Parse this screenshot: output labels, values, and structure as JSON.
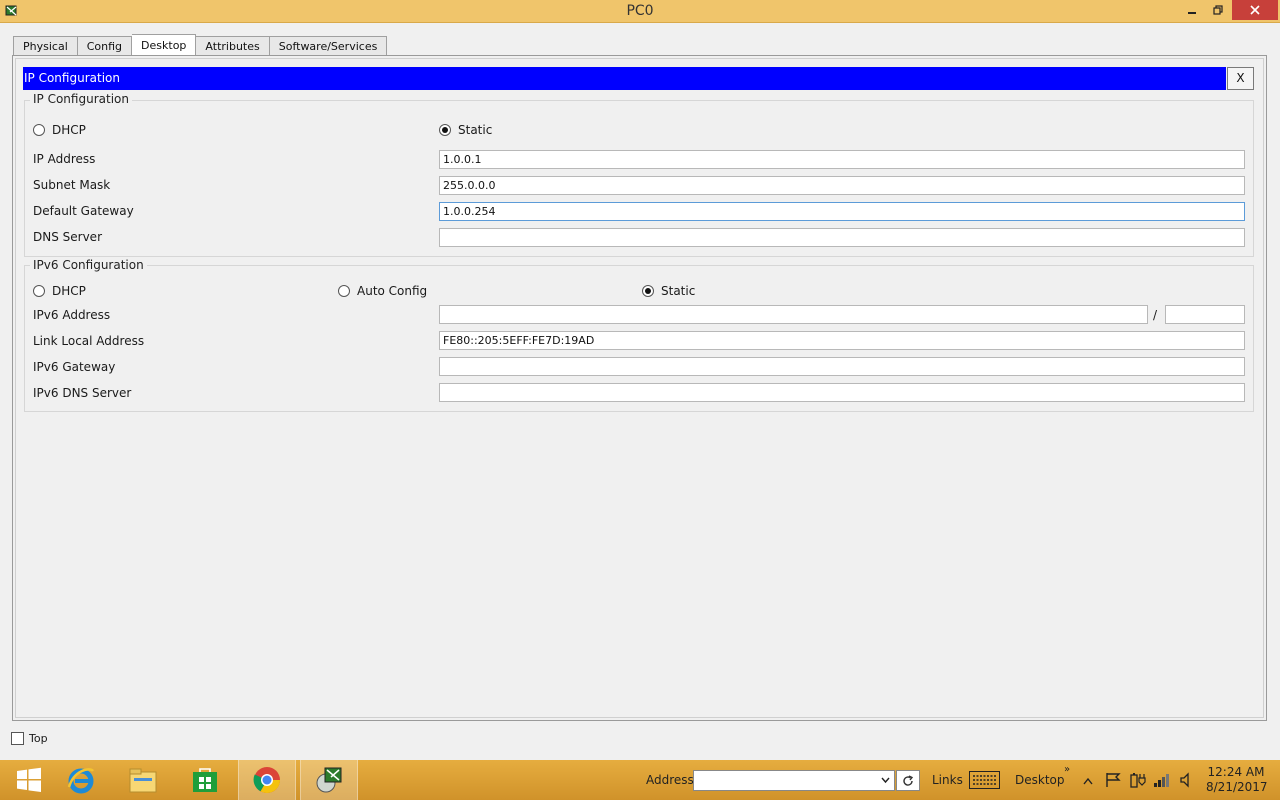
{
  "window": {
    "title": "PC0"
  },
  "tabs": [
    "Physical",
    "Config",
    "Desktop",
    "Attributes",
    "Software/Services"
  ],
  "ip_config": {
    "header": "IP Configuration",
    "close_label": "X",
    "ipv4": {
      "group_title": "IP Configuration",
      "dhcp_label": "DHCP",
      "static_label": "Static",
      "mode": "Static",
      "ip_address_label": "IP Address",
      "ip_address": "1.0.0.1",
      "subnet_mask_label": "Subnet Mask",
      "subnet_mask": "255.0.0.0",
      "default_gateway_label": "Default Gateway",
      "default_gateway": "1.0.0.254",
      "dns_server_label": "DNS Server",
      "dns_server": ""
    },
    "ipv6": {
      "group_title": "IPv6 Configuration",
      "dhcp_label": "DHCP",
      "auto_config_label": "Auto Config",
      "static_label": "Static",
      "mode": "Static",
      "ipv6_address_label": "IPv6 Address",
      "ipv6_address": "",
      "slash": "/",
      "prefix_length": "",
      "link_local_label": "Link Local Address",
      "link_local": "FE80::205:5EFF:FE7D:19AD",
      "ipv6_gateway_label": "IPv6 Gateway",
      "ipv6_gateway": "",
      "ipv6_dns_label": "IPv6 DNS Server",
      "ipv6_dns": ""
    }
  },
  "top_checkbox": {
    "label": "Top",
    "checked": false
  },
  "taskbar": {
    "address_label": "Address",
    "links_label": "Links",
    "desktop_label": "Desktop",
    "time": "12:24 AM",
    "date": "8/21/2017",
    "icons": [
      "start-icon",
      "internet-explorer-icon",
      "file-explorer-icon",
      "store-icon",
      "chrome-icon",
      "packet-tracer-icon"
    ]
  },
  "colors": {
    "accent_header": "#0000ff",
    "titlebar": "#f0c56b",
    "close_button": "#c7403a",
    "taskbar": "#e0a33a"
  }
}
